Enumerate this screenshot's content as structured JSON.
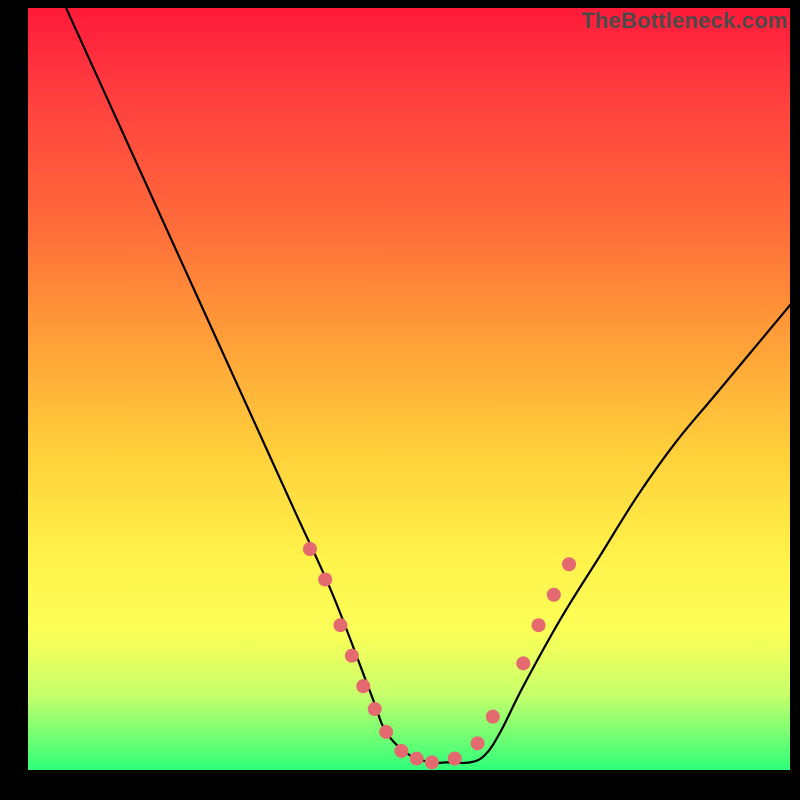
{
  "watermark": "TheBottleneck.com",
  "chart_data": {
    "type": "line",
    "title": "",
    "xlabel": "",
    "ylabel": "",
    "xlim": [
      0,
      100
    ],
    "ylim": [
      0,
      100
    ],
    "series": [
      {
        "name": "curve",
        "x": [
          5,
          10,
          15,
          20,
          25,
          30,
          35,
          40,
          45,
          47,
          50,
          53,
          55,
          58,
          60,
          62,
          65,
          70,
          75,
          80,
          85,
          90,
          95,
          100
        ],
        "y": [
          100,
          89,
          78,
          67,
          56,
          45,
          34,
          23,
          10,
          5,
          2,
          1,
          1,
          1,
          2,
          5,
          11,
          20,
          28,
          36,
          43,
          49,
          55,
          61
        ]
      }
    ],
    "markers": [
      {
        "x": 37,
        "y": 29
      },
      {
        "x": 39,
        "y": 25
      },
      {
        "x": 41,
        "y": 19
      },
      {
        "x": 42.5,
        "y": 15
      },
      {
        "x": 44,
        "y": 11
      },
      {
        "x": 45.5,
        "y": 8
      },
      {
        "x": 47,
        "y": 5
      },
      {
        "x": 49,
        "y": 2.5
      },
      {
        "x": 51,
        "y": 1.5
      },
      {
        "x": 53,
        "y": 1
      },
      {
        "x": 56,
        "y": 1.5
      },
      {
        "x": 59,
        "y": 3.5
      },
      {
        "x": 61,
        "y": 7
      },
      {
        "x": 65,
        "y": 14
      },
      {
        "x": 67,
        "y": 19
      },
      {
        "x": 69,
        "y": 23
      },
      {
        "x": 71,
        "y": 27
      }
    ],
    "marker_radius_px": 7,
    "marker_fill": "#e46a6f",
    "gradient_stops": [
      {
        "pos": 0.0,
        "color": "#ff1a3a"
      },
      {
        "pos": 0.28,
        "color": "#ff6a3a"
      },
      {
        "pos": 0.58,
        "color": "#ffcf3a"
      },
      {
        "pos": 0.82,
        "color": "#fbff58"
      },
      {
        "pos": 1.0,
        "color": "#2fff7a"
      }
    ]
  }
}
